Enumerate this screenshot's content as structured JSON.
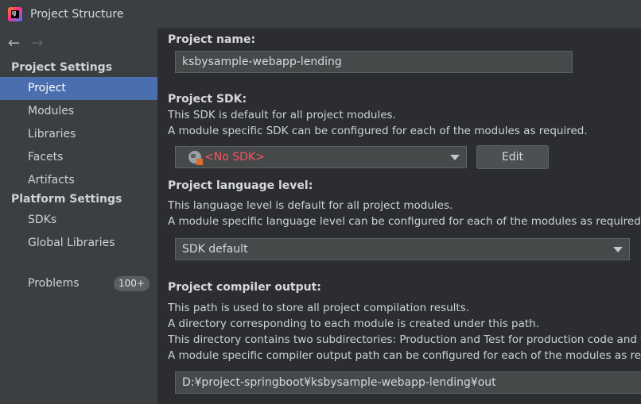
{
  "window": {
    "title": "Project Structure"
  },
  "sidebar": {
    "groups": [
      {
        "title": "Project Settings",
        "items": [
          {
            "label": "Project",
            "selected": true
          },
          {
            "label": "Modules"
          },
          {
            "label": "Libraries"
          },
          {
            "label": "Facets"
          },
          {
            "label": "Artifacts"
          }
        ]
      },
      {
        "title": "Platform Settings",
        "items": [
          {
            "label": "SDKs"
          },
          {
            "label": "Global Libraries"
          }
        ]
      }
    ],
    "problems": {
      "label": "Problems",
      "badge": "100+"
    }
  },
  "main": {
    "project_name": {
      "label": "Project name:",
      "value": "ksbysample-webapp-lending"
    },
    "sdk": {
      "label": "Project SDK:",
      "desc1": "This SDK is default for all project modules.",
      "desc2": "A module specific SDK can be configured for each of the modules as required.",
      "value": "<No SDK>",
      "edit_label": "Edit"
    },
    "language": {
      "label": "Project language level:",
      "desc1": "This language level is default for all project modules.",
      "desc2": "A module specific language level can be configured for each of the modules as required.",
      "value": "SDK default"
    },
    "compiler": {
      "label": "Project compiler output:",
      "desc1": "This path is used to store all project compilation results.",
      "desc2": "A directory corresponding to each module is created under this path.",
      "desc3": "This directory contains two subdirectories: Production and Test for production code and te",
      "desc4": "A module specific compiler output path can be configured for each of the modules as requ",
      "value": "D:¥project-springboot¥ksbysample-webapp-lending¥out"
    }
  },
  "colors": {
    "selected": "#4b6eaf",
    "error": "#ff5261"
  }
}
